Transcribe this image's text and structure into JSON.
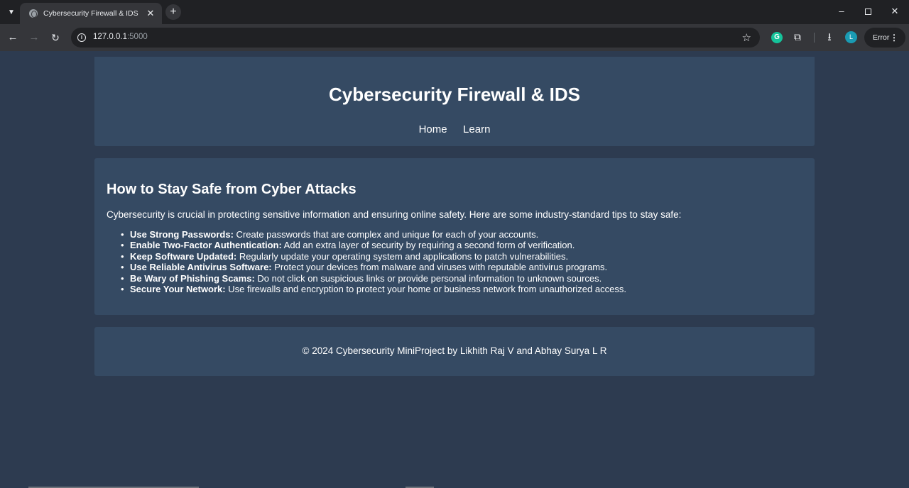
{
  "browser": {
    "tab_title": "Cybersecurity Firewall & IDS",
    "new_tab_label": "+",
    "url_host": "127.0.0.1",
    "url_port": ":5000",
    "profile_initial": "L",
    "error_label": "Error",
    "extension_g": "G"
  },
  "site": {
    "title": "Cybersecurity Firewall & IDS",
    "nav": [
      "Home",
      "Learn"
    ]
  },
  "content": {
    "heading": "How to Stay Safe from Cyber Attacks",
    "intro": "Cybersecurity is crucial in protecting sensitive information and ensuring online safety. Here are some industry-standard tips to stay safe:",
    "tips": [
      {
        "title": "Use Strong Passwords:",
        "text": " Create passwords that are complex and unique for each of your accounts."
      },
      {
        "title": "Enable Two-Factor Authentication:",
        "text": " Add an extra layer of security by requiring a second form of verification."
      },
      {
        "title": "Keep Software Updated:",
        "text": " Regularly update your operating system and applications to patch vulnerabilities."
      },
      {
        "title": "Use Reliable Antivirus Software:",
        "text": " Protect your devices from malware and viruses with reputable antivirus programs."
      },
      {
        "title": "Be Wary of Phishing Scams:",
        "text": " Do not click on suspicious links or provide personal information to unknown sources."
      },
      {
        "title": "Secure Your Network:",
        "text": " Use firewalls and encryption to protect your home or business network from unauthorized access."
      }
    ]
  },
  "footer": {
    "text": "© 2024 Cybersecurity MiniProject by Likhith Raj V and Abhay Surya L R"
  },
  "colors": {
    "page_bg": "#2d3b50",
    "card_bg": "#354a63",
    "text": "#ffffff"
  }
}
